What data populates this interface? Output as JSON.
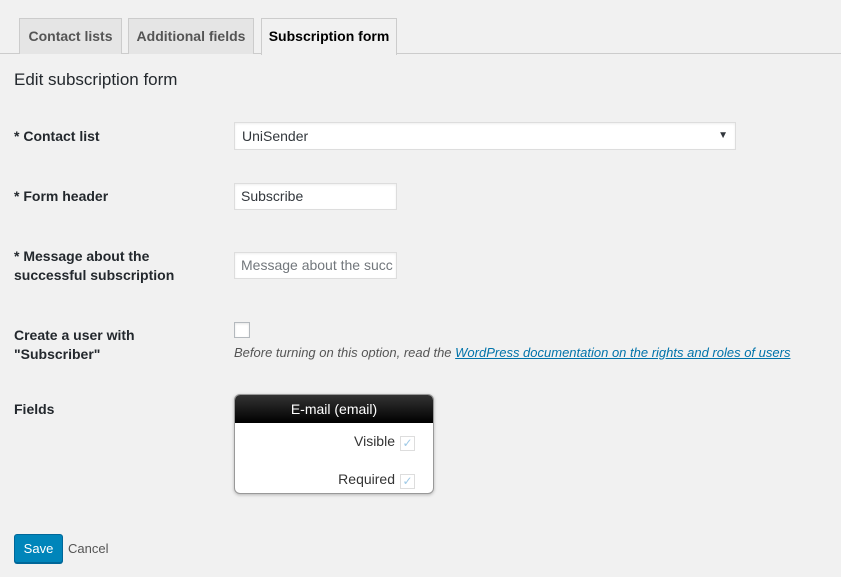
{
  "tabs": [
    {
      "label": "Contact lists",
      "active": false
    },
    {
      "label": "Additional fields",
      "active": false
    },
    {
      "label": "Subscription form",
      "active": true
    }
  ],
  "page_title": "Edit subscription form",
  "form": {
    "contact_list": {
      "label": "* Contact list",
      "value": "UniSender"
    },
    "form_header": {
      "label": "* Form header",
      "value": "Subscribe"
    },
    "success_message": {
      "label": "* Message about the successful subscription",
      "placeholder": "Message about the succ"
    },
    "create_user": {
      "label": "Create a user with \"Subscriber\"",
      "checked": false,
      "hint_prefix": "Before turning on this option, read the ",
      "hint_link": "WordPress documentation on the rights and roles of users"
    },
    "fields": {
      "label": "Fields",
      "card_title": "E-mail (email)",
      "visible_label": "Visible",
      "required_label": "Required",
      "visible_checked": true,
      "required_checked": true
    }
  },
  "actions": {
    "save_label": "Save",
    "cancel_label": "Cancel"
  },
  "colors": {
    "primary": "#0085ba",
    "link": "#0073aa",
    "background": "#f1f1f1"
  }
}
